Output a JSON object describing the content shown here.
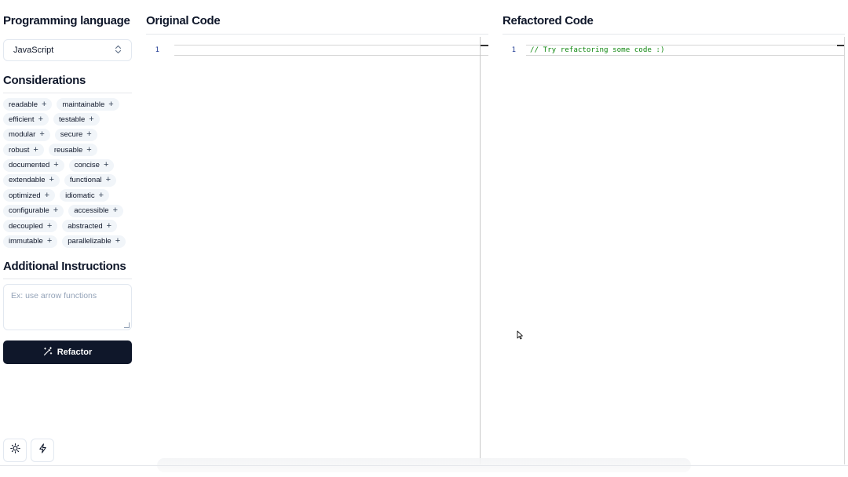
{
  "sidebar": {
    "language_heading": "Programming language",
    "language_value": "JavaScript",
    "considerations_heading": "Considerations",
    "considerations": [
      [
        "readable",
        "maintainable"
      ],
      [
        "efficient",
        "testable"
      ],
      [
        "modular",
        "secure"
      ],
      [
        "robust",
        "reusable"
      ],
      [
        "documented",
        "concise"
      ],
      [
        "extendable",
        "functional"
      ],
      [
        "optimized",
        "idiomatic"
      ],
      [
        "configurable",
        "accessible"
      ],
      [
        "decoupled",
        "abstracted"
      ],
      [
        "immutable",
        "parallelizable"
      ]
    ],
    "add_icon": "+",
    "instructions_heading": "Additional Instructions",
    "instructions_placeholder": "Ex: use arrow functions",
    "refactor_label": "Refactor"
  },
  "original": {
    "title": "Original Code",
    "line_number": "1",
    "code": ""
  },
  "refactored": {
    "title": "Refactored Code",
    "line_number": "1",
    "code": "// Try refactoring some code :)"
  },
  "icons": {
    "select_chevron": "chevrons-up-down-icon",
    "refactor": "wand-icon",
    "theme": "sun-icon",
    "flash": "lightning-icon"
  },
  "colors": {
    "primary": "#0f172a",
    "chip_bg": "#f1f5f9",
    "comment": "#118811",
    "line_number": "#1f3a93"
  }
}
